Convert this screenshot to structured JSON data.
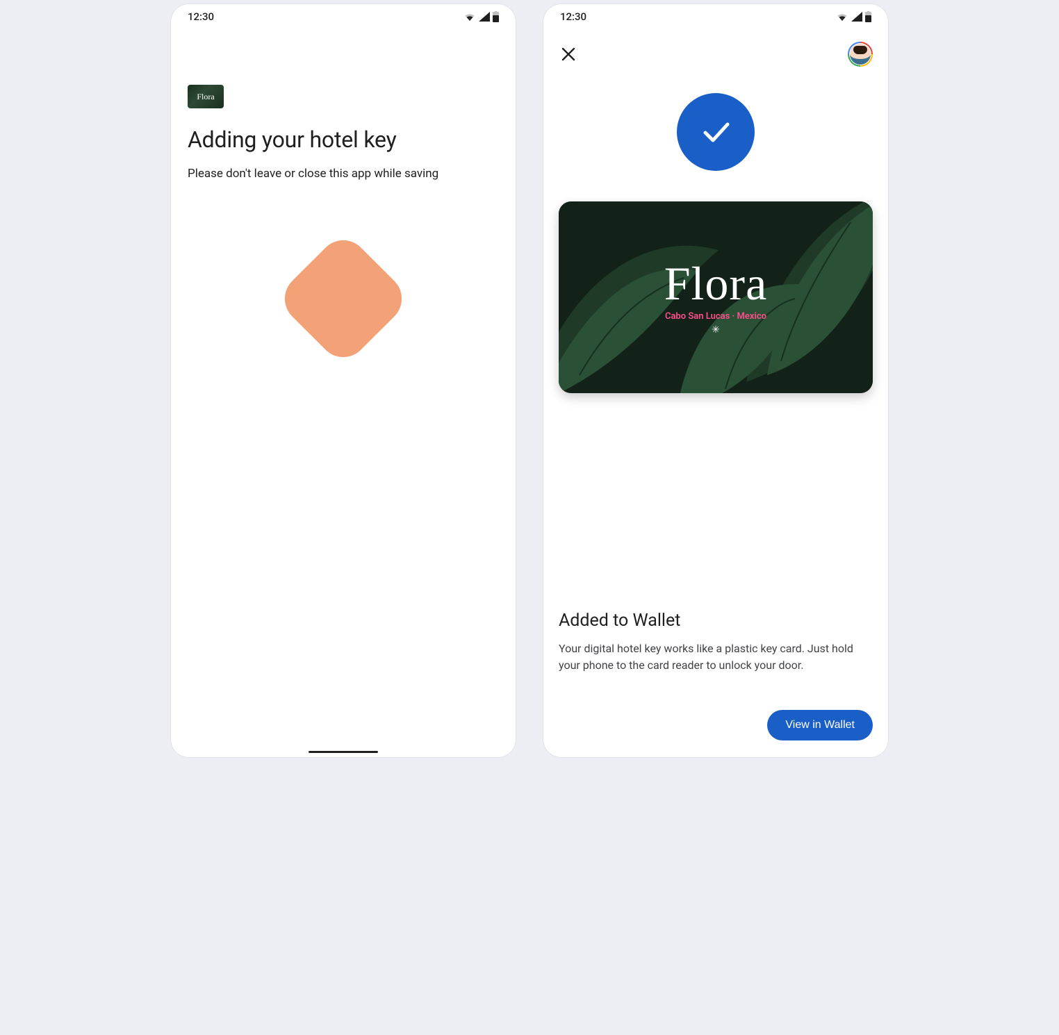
{
  "status": {
    "time": "12:30"
  },
  "screen1": {
    "brand": "Flora",
    "title": "Adding your hotel key",
    "subtitle": "Please don't leave or close this app while saving"
  },
  "screen2": {
    "card": {
      "brand": "Flora",
      "location": "Cabo San Lucas · Mexico"
    },
    "title": "Added to Wallet",
    "description": "Your digital hotel key works like a plastic key card. Just hold your phone to the card reader to unlock your door.",
    "cta": "View in Wallet"
  }
}
